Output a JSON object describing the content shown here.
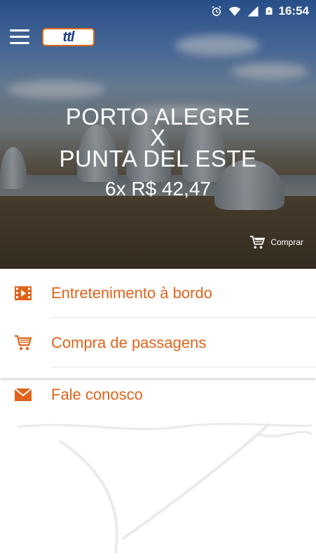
{
  "status_bar": {
    "time": "16:54",
    "icons": [
      "alarm-icon",
      "wifi-icon",
      "signal-icon",
      "battery-icon"
    ]
  },
  "app_bar": {
    "menu_icon": "hamburger-menu-icon",
    "logo_text": "ttl"
  },
  "hero": {
    "origin": "PORTO ALEGRE",
    "separator": "X",
    "destination": "PUNTA DEL ESTE",
    "price": "6x R$ 42,47",
    "buy_label": "Comprar",
    "buy_icon": "shopping-cart-icon"
  },
  "menu": {
    "items": [
      {
        "label": "Entretenimento à bordo",
        "icon": "film-icon"
      },
      {
        "label": "Compra de passagens",
        "icon": "shopping-cart-icon"
      },
      {
        "label": "Fale conosco",
        "icon": "envelope-icon"
      }
    ]
  },
  "colors": {
    "accent": "#e0631a",
    "brand_blue": "#1b3d8f"
  }
}
